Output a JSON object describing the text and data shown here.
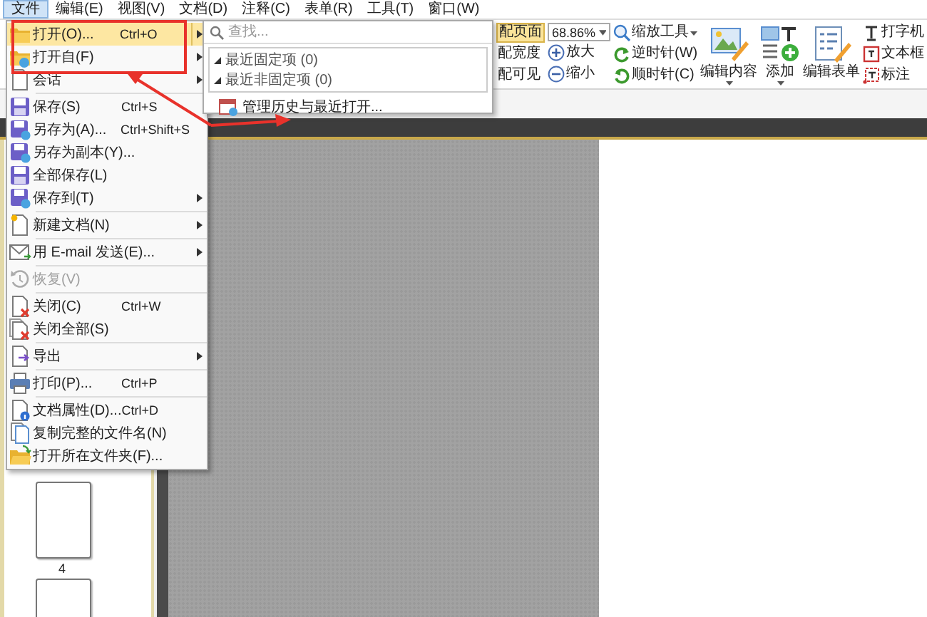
{
  "menubar": [
    {
      "label": "文件",
      "selected": true
    },
    {
      "label": "编辑(E)",
      "selected": false
    },
    {
      "label": "视图(V)",
      "selected": false
    },
    {
      "label": "文档(D)",
      "selected": false
    },
    {
      "label": "注释(C)",
      "selected": false
    },
    {
      "label": "表单(R)",
      "selected": false
    },
    {
      "label": "工具(T)",
      "selected": false
    },
    {
      "label": "窗口(W)",
      "selected": false
    }
  ],
  "ribbon": {
    "fit_buttons": [
      {
        "label": "配页面",
        "selected": true
      },
      {
        "label": "配宽度",
        "selected": false
      },
      {
        "label": "配可见",
        "selected": false
      }
    ],
    "zoom_field": {
      "value": "68.86%"
    },
    "zoom_buttons": [
      "放大",
      "缩小"
    ],
    "zoom_tool": "缩放工具",
    "rotate_buttons": [
      "逆时针(W)",
      "顺时针(C)"
    ],
    "large_buttons": [
      {
        "label": "编辑内容",
        "has_menu": true
      },
      {
        "label": "添加",
        "has_menu": true
      },
      {
        "label": "编辑表单",
        "has_menu": false
      }
    ],
    "annotation_tools": [
      "打字机",
      "文本框",
      "标注"
    ]
  },
  "file_menu": {
    "items": [
      {
        "kind": "item",
        "label": "打开(O)...",
        "shortcut": "Ctrl+O",
        "submenu": true,
        "selected": true,
        "disabled": false
      },
      {
        "kind": "item",
        "label": "打开自(F)",
        "submenu": true,
        "selected": false,
        "disabled": false
      },
      {
        "kind": "item",
        "label": "会话",
        "submenu": true,
        "selected": false,
        "disabled": false
      },
      {
        "kind": "separator"
      },
      {
        "kind": "item",
        "label": "保存(S)",
        "shortcut": "Ctrl+S",
        "submenu": false,
        "selected": false,
        "disabled": false
      },
      {
        "kind": "item",
        "label": "另存为(A)...",
        "shortcut": "Ctrl+Shift+S",
        "submenu": false,
        "selected": false,
        "disabled": false
      },
      {
        "kind": "item",
        "label": "另存为副本(Y)...",
        "submenu": false,
        "selected": false,
        "disabled": false
      },
      {
        "kind": "item",
        "label": "全部保存(L)",
        "submenu": false,
        "selected": false,
        "disabled": false
      },
      {
        "kind": "item",
        "label": "保存到(T)",
        "submenu": true,
        "selected": false,
        "disabled": false
      },
      {
        "kind": "separator"
      },
      {
        "kind": "item",
        "label": "新建文档(N)",
        "submenu": true,
        "selected": false,
        "disabled": false
      },
      {
        "kind": "separator"
      },
      {
        "kind": "item",
        "label": "用 E-mail 发送(E)...",
        "submenu": true,
        "selected": false,
        "disabled": false
      },
      {
        "kind": "separator"
      },
      {
        "kind": "item",
        "label": "恢复(V)",
        "submenu": false,
        "selected": false,
        "disabled": true
      },
      {
        "kind": "separator"
      },
      {
        "kind": "item",
        "label": "关闭(C)",
        "shortcut": "Ctrl+W",
        "submenu": false,
        "selected": false,
        "disabled": false
      },
      {
        "kind": "item",
        "label": "关闭全部(S)",
        "submenu": false,
        "selected": false,
        "disabled": false
      },
      {
        "kind": "separator"
      },
      {
        "kind": "item",
        "label": "导出",
        "submenu": true,
        "selected": false,
        "disabled": false
      },
      {
        "kind": "separator"
      },
      {
        "kind": "item",
        "label": "打印(P)...",
        "shortcut": "Ctrl+P",
        "submenu": false,
        "selected": false,
        "disabled": false
      },
      {
        "kind": "separator"
      },
      {
        "kind": "item",
        "label": "文档属性(D)...",
        "shortcut": "Ctrl+D",
        "submenu": false,
        "selected": false,
        "disabled": false
      },
      {
        "kind": "item",
        "label": "复制完整的文件名(N)",
        "submenu": false,
        "selected": false,
        "disabled": false
      },
      {
        "kind": "item",
        "label": "打开所在文件夹(F)...",
        "submenu": false,
        "selected": false,
        "disabled": false
      }
    ]
  },
  "open_submenu": {
    "search": {
      "placeholder": "查找..."
    },
    "groups": [
      {
        "label": "最近固定项 (0)",
        "expanded": true
      },
      {
        "label": "最近非固定项 (0)",
        "expanded": true
      }
    ],
    "items": [
      "管理历史与最近打开..."
    ]
  },
  "thumbnails": [
    {
      "label": "4"
    }
  ]
}
